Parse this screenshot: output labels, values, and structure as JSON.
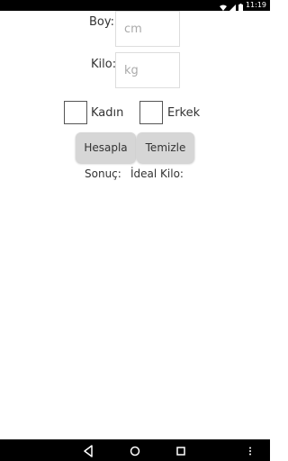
{
  "status_bar": {
    "time": "11:19",
    "icons": [
      "wifi-icon",
      "signal-icon",
      "battery-icon"
    ]
  },
  "form": {
    "boy_label": "Boy:",
    "boy_placeholder": "cm",
    "kilo_label": "Kilo:",
    "kilo_placeholder": "kg",
    "gender": {
      "female_label": "Kadın",
      "male_label": "Erkek"
    },
    "buttons": {
      "calculate_label": "Hesapla",
      "clear_label": "Temizle"
    },
    "result_label": "Sonuç:",
    "ideal_weight_label": "İdeal Kilo:"
  },
  "nav_bar": {
    "icons": [
      "back-icon",
      "home-icon",
      "recents-icon",
      "overflow-menu-icon"
    ]
  }
}
